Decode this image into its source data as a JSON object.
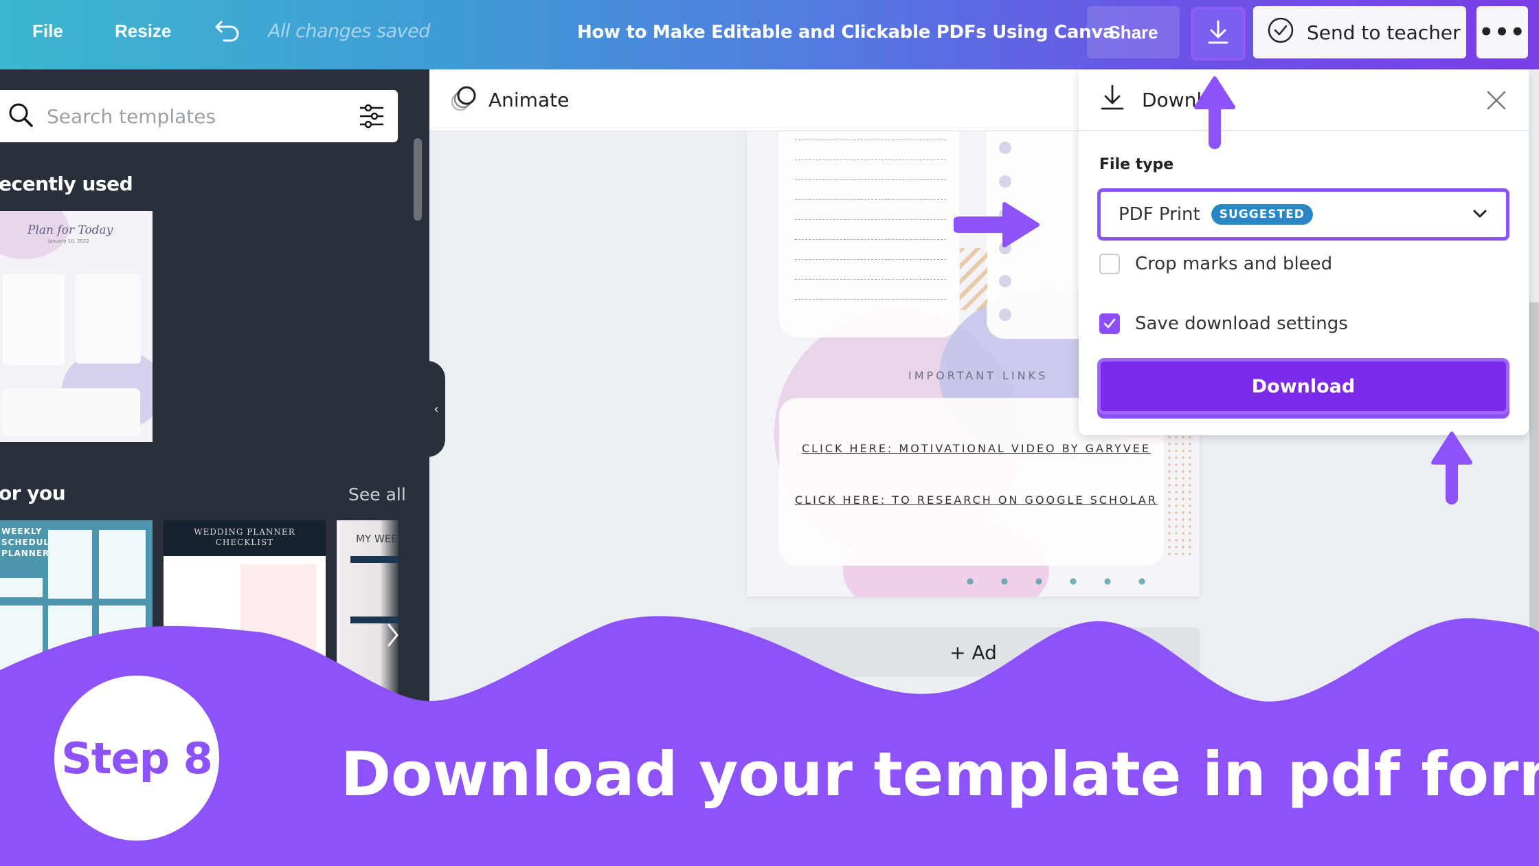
{
  "topbar": {
    "file_label": "File",
    "resize_label": "Resize",
    "undo_icon": "undo-icon",
    "save_status": "All changes saved",
    "document_title": "How to Make Editable and Clickable PDFs Using Canva",
    "share_label": "Share",
    "download_icon": "download-icon",
    "send_to_teacher_label": "Send to teacher",
    "more_label": "•••"
  },
  "sidebar": {
    "search_placeholder": "Search templates",
    "recently_used_heading": "ecently used",
    "recent_templates": [
      {
        "title": "Plan for Today",
        "date": "January 10, 2022"
      }
    ],
    "for_you_heading": "or you",
    "see_all_label": "See all",
    "for_you_templates": [
      {
        "title": "WEEKLY SCHEDULE PLANNER"
      },
      {
        "title": "WEDDING PLANNER CHECKLIST"
      },
      {
        "title": "MY WEE"
      }
    ]
  },
  "editor": {
    "animate_label": "Animate",
    "page": {
      "important_links_heading": "IMPORTANT LINKS",
      "links": [
        "CLICK HERE: MOTIVATIONAL VIDEO BY GARYVEE",
        "CLICK HERE: TO RESEARCH ON GOOGLE SCHOLAR"
      ]
    },
    "add_page_label": "+ Ad"
  },
  "download_panel": {
    "title": "Downlo",
    "file_type_label": "File type",
    "file_type_value": "PDF Print",
    "suggested_badge": "SUGGESTED",
    "crop_marks_label": "Crop marks and bleed",
    "crop_marks_checked": false,
    "save_settings_label": "Save download settings",
    "save_settings_checked": true,
    "download_button_label": "Download"
  },
  "banner": {
    "step_label": "Step 8",
    "caption": "Download your template in pdf format"
  },
  "colors": {
    "accent_purple": "#8c52fb",
    "button_purple": "#7a2ae8",
    "sidebar_dark": "#293039",
    "badge_blue": "#2b86c5"
  }
}
